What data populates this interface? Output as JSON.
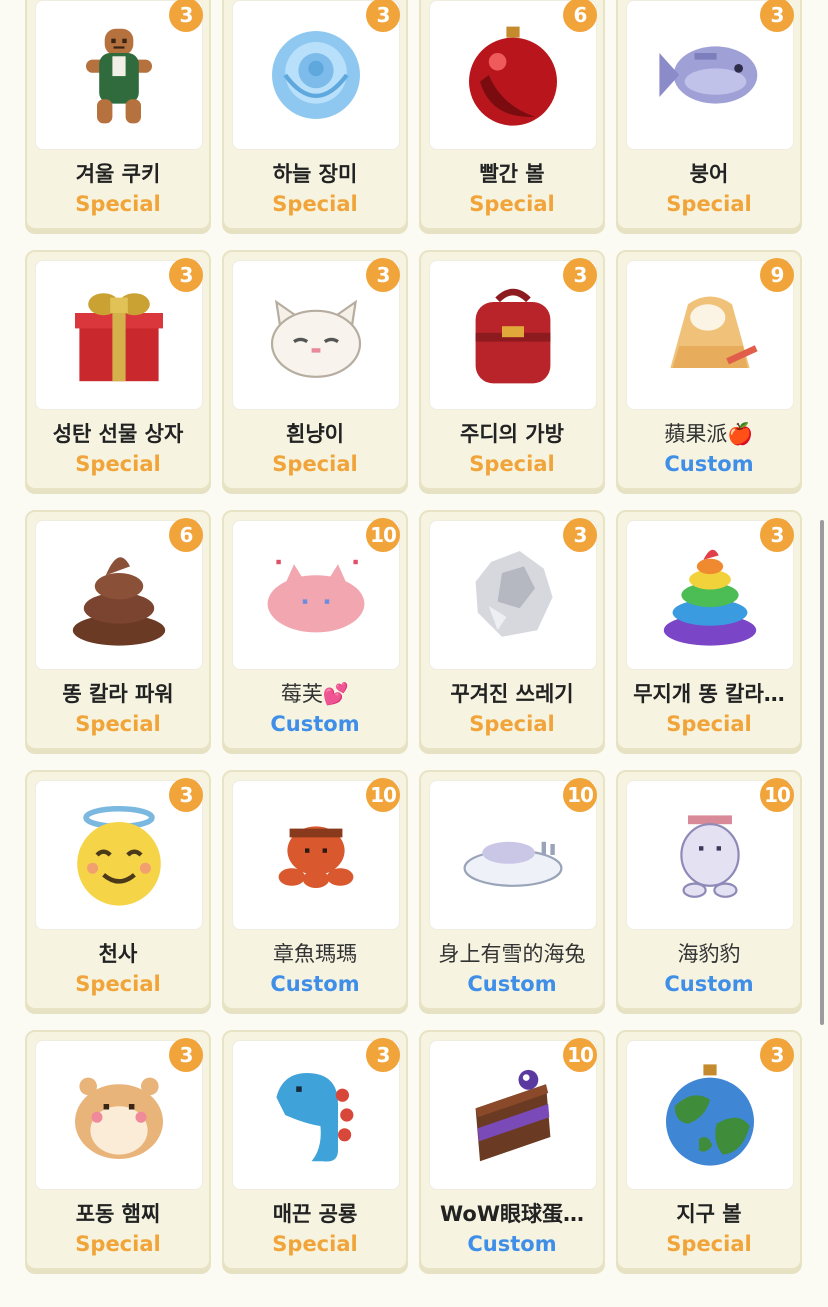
{
  "items": [
    {
      "name": "겨울 쿠키",
      "count": "3",
      "type": "Special",
      "icon": "gingerbread-cookie-icon"
    },
    {
      "name": "하늘 장미",
      "count": "3",
      "type": "Special",
      "icon": "blue-rose-icon"
    },
    {
      "name": "빨간 볼",
      "count": "6",
      "type": "Special",
      "icon": "red-ornament-icon"
    },
    {
      "name": "붕어",
      "count": "3",
      "type": "Special",
      "icon": "fish-bread-icon"
    },
    {
      "name": "성탄 선물 상자",
      "count": "3",
      "type": "Special",
      "icon": "gift-box-icon"
    },
    {
      "name": "흰냥이",
      "count": "3",
      "type": "Special",
      "icon": "white-cat-icon"
    },
    {
      "name": "주디의 가방",
      "count": "3",
      "type": "Special",
      "icon": "red-backpack-icon"
    },
    {
      "name": "蘋果派🍎",
      "count": "9",
      "type": "Custom",
      "icon": "apple-pie-icon"
    },
    {
      "name": "똥 칼라 파워",
      "count": "6",
      "type": "Special",
      "icon": "poop-icon"
    },
    {
      "name": "莓芙💕",
      "count": "10",
      "type": "Custom",
      "icon": "pink-creature-icon"
    },
    {
      "name": "꾸겨진 쓰레기",
      "count": "3",
      "type": "Special",
      "icon": "crumpled-paper-icon"
    },
    {
      "name": "무지개 똥 칼라…",
      "count": "3",
      "type": "Special",
      "icon": "rainbow-poop-icon"
    },
    {
      "name": "천사",
      "count": "3",
      "type": "Special",
      "icon": "angel-emoji-icon"
    },
    {
      "name": "章魚瑪瑪",
      "count": "10",
      "type": "Custom",
      "icon": "octopus-icon"
    },
    {
      "name": "身上有雪的海兔",
      "count": "10",
      "type": "Custom",
      "icon": "sea-bunny-icon"
    },
    {
      "name": "海豹豹",
      "count": "10",
      "type": "Custom",
      "icon": "seal-icon"
    },
    {
      "name": "포동 햄찌",
      "count": "3",
      "type": "Special",
      "icon": "hamster-icon"
    },
    {
      "name": "매끈 공룡",
      "count": "3",
      "type": "Special",
      "icon": "dinosaur-icon"
    },
    {
      "name": "WoW眼球蛋…",
      "count": "10",
      "type": "Custom",
      "icon": "cake-slice-icon"
    },
    {
      "name": "지구 볼",
      "count": "3",
      "type": "Special",
      "icon": "earth-ornament-icon"
    }
  ]
}
